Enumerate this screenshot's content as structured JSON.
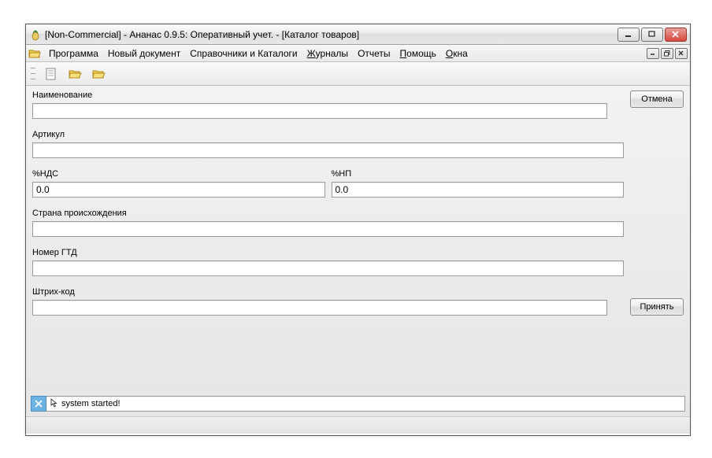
{
  "window": {
    "title": "[Non-Commercial] - Ананас 0.9.5: Оперативный учет. - [Каталог товаров]"
  },
  "menu": {
    "program": "Программа",
    "new_doc": "Новый документ",
    "catalogs": "Справочники и Каталоги",
    "journals": "Журналы",
    "reports": "Отчеты",
    "help": "Помощь",
    "windows": "Окна"
  },
  "form": {
    "name": {
      "label": "Наименование",
      "value": ""
    },
    "article": {
      "label": "Артикул",
      "value": ""
    },
    "vat": {
      "label": "%НДС",
      "value": "0.0"
    },
    "np": {
      "label": "%НП",
      "value": "0.0"
    },
    "origin": {
      "label": "Страна происхождения",
      "value": ""
    },
    "gtd": {
      "label": "Номер ГТД",
      "value": ""
    },
    "barcode": {
      "label": "Штрих-код",
      "value": ""
    }
  },
  "buttons": {
    "cancel": "Отмена",
    "accept": "Принять"
  },
  "status": {
    "message": "system started!"
  }
}
